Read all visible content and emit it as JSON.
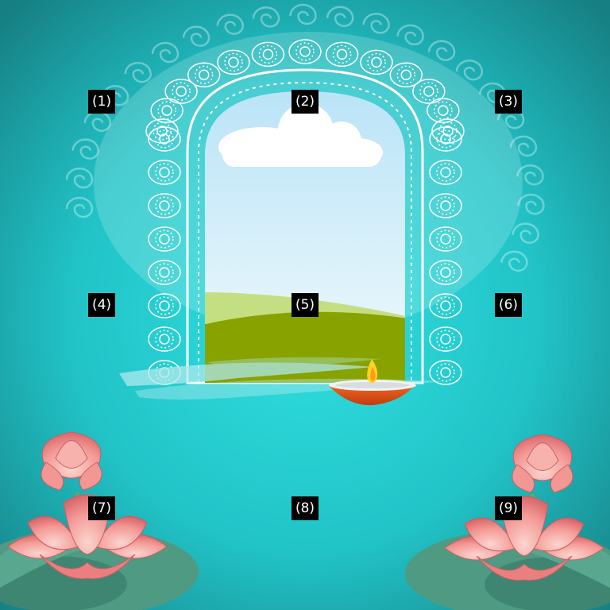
{
  "markers": [
    {
      "label": "(1)"
    },
    {
      "label": "(2)"
    },
    {
      "label": "(3)"
    },
    {
      "label": "(4)"
    },
    {
      "label": "(5)"
    },
    {
      "label": "(6)"
    },
    {
      "label": "(7)"
    },
    {
      "label": "(8)"
    },
    {
      "label": "(9)"
    }
  ],
  "colors": {
    "background_top": "#1c8f92",
    "background_mid": "#27d3d6",
    "background_bottom": "#138a8e",
    "sky": "#d8f0fb",
    "hill_light": "#c3dd7e",
    "hill_dark": "#88a200",
    "lamp": "#e04a14",
    "flame": "#ffd21f",
    "lotus": "#f59b9b",
    "leaf": "#4f9a83"
  },
  "icons": [
    "window-arch",
    "diya-lamp",
    "lotus-flower",
    "lotus-leaf",
    "cloud"
  ]
}
